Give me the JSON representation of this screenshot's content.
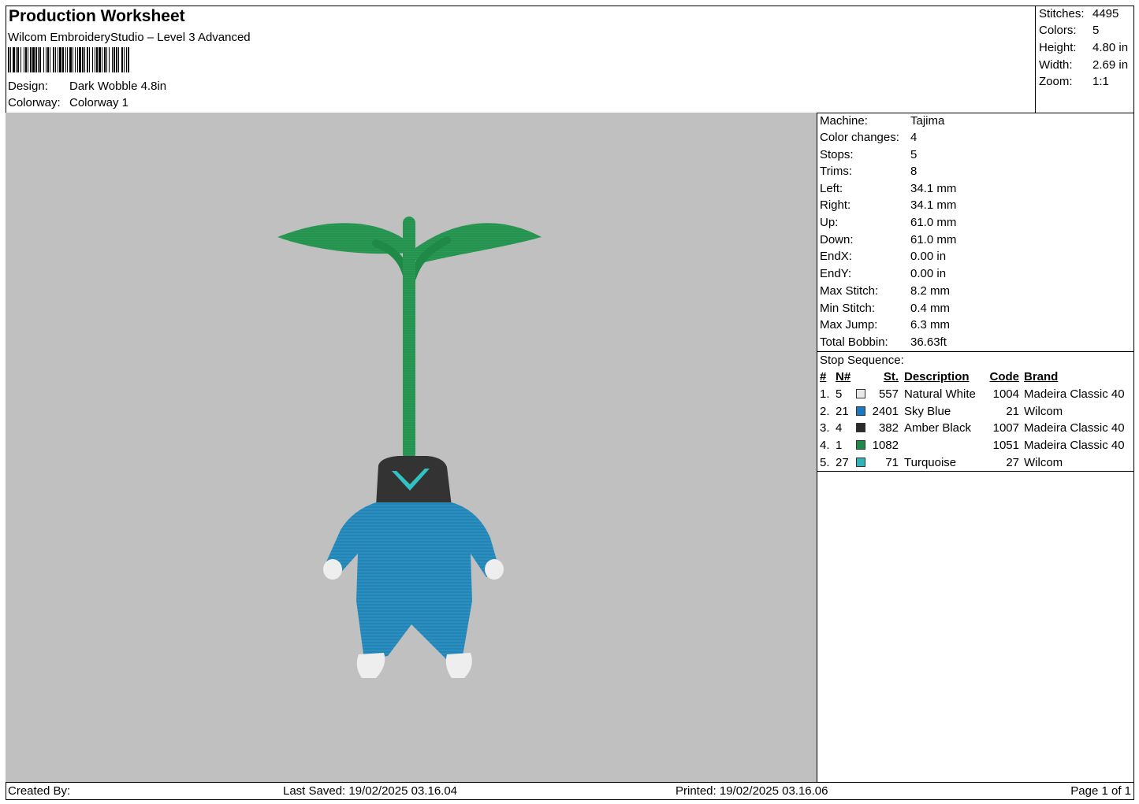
{
  "header": {
    "title": "Production Worksheet",
    "software": "Wilcom EmbroideryStudio – Level 3 Advanced",
    "design_label": "Design:",
    "design_value": "Dark Wobble 4.8in",
    "colorway_label": "Colorway:",
    "colorway_value": "Colorway 1"
  },
  "summary": [
    {
      "label": "Stitches:",
      "value": "4495"
    },
    {
      "label": "Colors:",
      "value": "5"
    },
    {
      "label": "Height:",
      "value": "4.80 in"
    },
    {
      "label": "Width:",
      "value": "2.69 in"
    },
    {
      "label": "Zoom:",
      "value": "1:1"
    }
  ],
  "machine_info": [
    {
      "label": "Machine:",
      "value": "Tajima"
    },
    {
      "label": "Color changes:",
      "value": "4"
    },
    {
      "label": "Stops:",
      "value": "5"
    },
    {
      "label": "Trims:",
      "value": "8"
    },
    {
      "label": "Left:",
      "value": "34.1 mm"
    },
    {
      "label": "Right:",
      "value": "34.1 mm"
    },
    {
      "label": "Up:",
      "value": "61.0 mm"
    },
    {
      "label": "Down:",
      "value": "61.0 mm"
    },
    {
      "label": "EndX:",
      "value": "0.00 in"
    },
    {
      "label": "EndY:",
      "value": "0.00 in"
    },
    {
      "label": "Max Stitch:",
      "value": "8.2 mm"
    },
    {
      "label": "Min Stitch:",
      "value": "0.4 mm"
    },
    {
      "label": "Max Jump:",
      "value": "6.3 mm"
    },
    {
      "label": "Total Bobbin:",
      "value": "36.63ft"
    }
  ],
  "stop_sequence": {
    "title": "Stop Sequence:",
    "headers": {
      "num": "#",
      "n": "N#",
      "st": "St.",
      "desc": "Description",
      "code": "Code",
      "brand": "Brand"
    },
    "rows": [
      {
        "num": "1.",
        "n": "5",
        "color": "#e8e8e8",
        "st": "557",
        "desc": "Natural White",
        "code": "1004",
        "brand": "Madeira Classic 40"
      },
      {
        "num": "2.",
        "n": "21",
        "color": "#1a78c2",
        "st": "2401",
        "desc": "Sky Blue",
        "code": "21",
        "brand": "Wilcom"
      },
      {
        "num": "3.",
        "n": "4",
        "color": "#2b2b2b",
        "st": "382",
        "desc": "Amber Black",
        "code": "1007",
        "brand": "Madeira Classic 40"
      },
      {
        "num": "4.",
        "n": "1",
        "color": "#1e8a4a",
        "st": "1082",
        "desc": "",
        "code": "1051",
        "brand": "Madeira Classic 40"
      },
      {
        "num": "5.",
        "n": "27",
        "color": "#2fb3b8",
        "st": "71",
        "desc": "Turquoise",
        "code": "27",
        "brand": "Wilcom"
      }
    ]
  },
  "footer": {
    "created_by": "Created By:",
    "last_saved": "Last Saved: 19/02/2025 03.16.04",
    "printed": "Printed: 19/02/2025 03.16.06",
    "page": "Page 1 of 1"
  },
  "colors": {
    "canvas": "#c0c0c0",
    "leaf_green": "#2a9a55",
    "stem_green": "#1f8a47",
    "body_blue": "#2a8fc0",
    "head_black": "#333333",
    "accent_turquoise": "#33c2c4",
    "glove_white": "#eeeeee"
  }
}
